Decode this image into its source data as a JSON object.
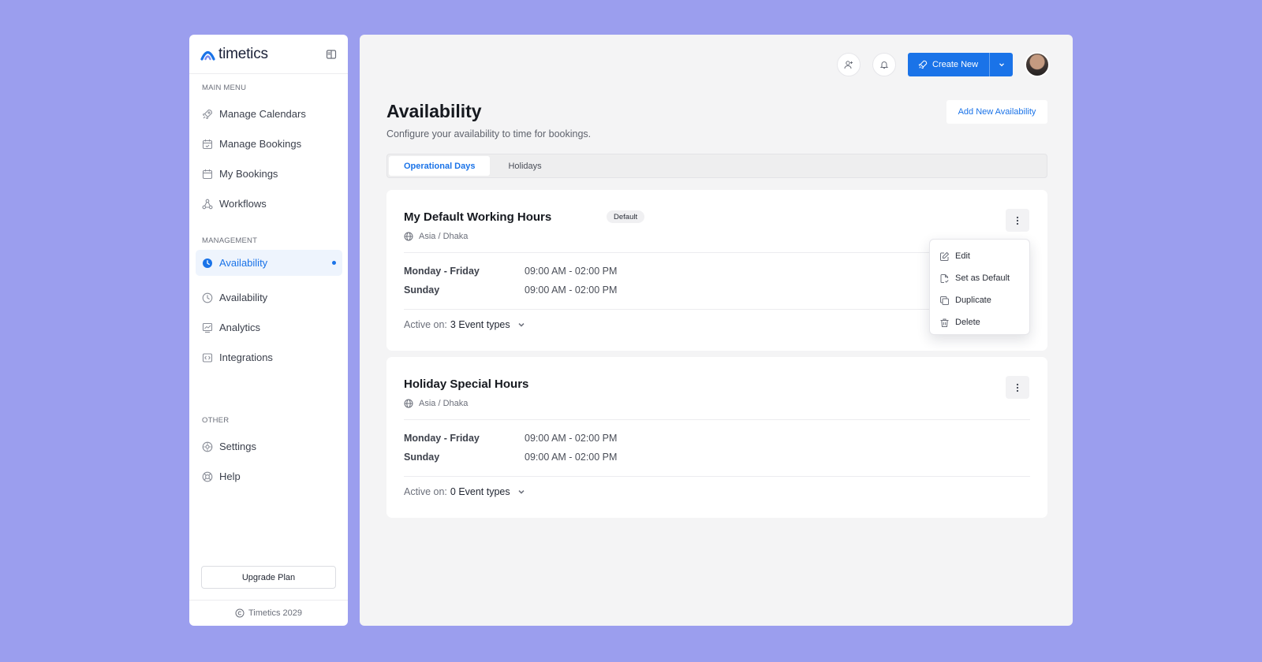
{
  "brand": {
    "name": "timetics",
    "accent": "#1a73e8",
    "background": "#9b9eee"
  },
  "sidebar": {
    "main_menu_label": "MAIN MENU",
    "main_items": [
      {
        "label": "Manage Calendars",
        "icon": "rocket-icon"
      },
      {
        "label": "Manage Bookings",
        "icon": "calendar-check-icon"
      },
      {
        "label": "My Bookings",
        "icon": "calendar-icon"
      },
      {
        "label": "Workflows",
        "icon": "workflow-icon"
      }
    ],
    "management_label": "MANAGEMENT",
    "management_items": [
      {
        "label": "Availability",
        "icon": "clock-filled-icon",
        "active": true
      },
      {
        "label": "Availability",
        "icon": "clock-icon"
      },
      {
        "label": "Analytics",
        "icon": "analytics-icon"
      },
      {
        "label": "Integrations",
        "icon": "integrations-icon"
      }
    ],
    "other_label": "OTHER",
    "other_items": [
      {
        "label": "Settings",
        "icon": "gear-icon"
      },
      {
        "label": "Help",
        "icon": "help-icon"
      }
    ],
    "upgrade_label": "Upgrade Plan",
    "footer_text": "Timetics 2029"
  },
  "header": {
    "create_label": "Create New",
    "add_user_icon": "add-user-icon",
    "notification_icon": "bell-icon"
  },
  "page": {
    "title": "Availability",
    "subtitle": "Configure your availability to time for bookings.",
    "add_button": "Add New Availability",
    "tabs": [
      {
        "label": "Operational Days",
        "active": true
      },
      {
        "label": "Holidays",
        "active": false
      }
    ]
  },
  "cards": [
    {
      "title": "My Default Working Hours",
      "badge": "Default",
      "timezone": "Asia / Dhaka",
      "schedule": [
        {
          "days": "Monday - Friday",
          "hours": "09:00 AM - 02:00 PM"
        },
        {
          "days": "Sunday",
          "hours": "09:00 AM - 02:00 PM"
        }
      ],
      "active_on_prefix": "Active on:",
      "active_on_value": "3 Event types"
    },
    {
      "title": "Holiday Special Hours",
      "badge": "",
      "timezone": "Asia / Dhaka",
      "schedule": [
        {
          "days": "Monday - Friday",
          "hours": "09:00 AM - 02:00 PM"
        },
        {
          "days": "Sunday",
          "hours": "09:00 AM - 02:00 PM"
        }
      ],
      "active_on_prefix": "Active on:",
      "active_on_value": "0 Event types"
    }
  ],
  "menu": {
    "items": [
      {
        "label": "Edit",
        "icon": "edit-icon"
      },
      {
        "label": "Set as Default",
        "icon": "file-check-icon"
      },
      {
        "label": "Duplicate",
        "icon": "duplicate-icon"
      },
      {
        "label": "Delete",
        "icon": "trash-icon"
      }
    ]
  }
}
